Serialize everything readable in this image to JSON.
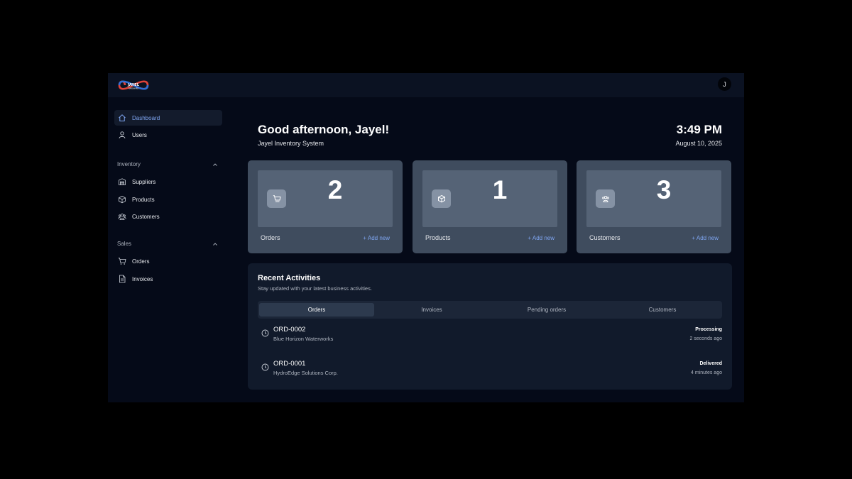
{
  "header": {
    "logo_text": "JAYEL",
    "logo_subtext": "HARDWARE",
    "avatar_initial": "J"
  },
  "sidebar": {
    "items": [
      {
        "label": "Dashboard",
        "icon": "home-icon",
        "active": true
      },
      {
        "label": "Users",
        "icon": "user-icon"
      }
    ],
    "sections": [
      {
        "title": "Inventory",
        "items": [
          {
            "label": "Suppliers",
            "icon": "warehouse-icon"
          },
          {
            "label": "Products",
            "icon": "box-icon"
          },
          {
            "label": "Customers",
            "icon": "users-group-icon"
          }
        ]
      },
      {
        "title": "Sales",
        "items": [
          {
            "label": "Orders",
            "icon": "cart-icon"
          },
          {
            "label": "Invoices",
            "icon": "document-icon"
          }
        ]
      }
    ]
  },
  "main": {
    "greeting": "Good afternoon, Jayel!",
    "subtitle": "Jayel Inventory System",
    "time": "3:49 PM",
    "date": "August 10, 2025",
    "stats": [
      {
        "label": "Orders",
        "value": "2",
        "add_label": "+ Add new",
        "icon": "cart-icon"
      },
      {
        "label": "Products",
        "value": "1",
        "add_label": "+ Add new",
        "icon": "box-icon"
      },
      {
        "label": "Customers",
        "value": "3",
        "add_label": "+ Add new",
        "icon": "users-group-icon"
      }
    ],
    "activity": {
      "title": "Recent Activities",
      "subtitle": "Stay updated with your latest business activities.",
      "tabs": [
        "Orders",
        "Invoices",
        "Pending orders",
        "Customers"
      ],
      "active_tab": "Orders",
      "rows": [
        {
          "id": "ORD-0002",
          "customer": "Blue Horizon Waterworks",
          "status": "Processing",
          "time_ago": "2 seconds ago"
        },
        {
          "id": "ORD-0001",
          "customer": "HydroEdge Solutions Corp.",
          "status": "Delivered",
          "time_ago": "4 minutes ago"
        }
      ]
    }
  },
  "colors": {
    "background": "#050a18",
    "topbar": "#0b1222",
    "accent": "#7fa6f2",
    "card": "#3f4c5e",
    "card_inner": "#556376",
    "panel": "#111a2b"
  }
}
